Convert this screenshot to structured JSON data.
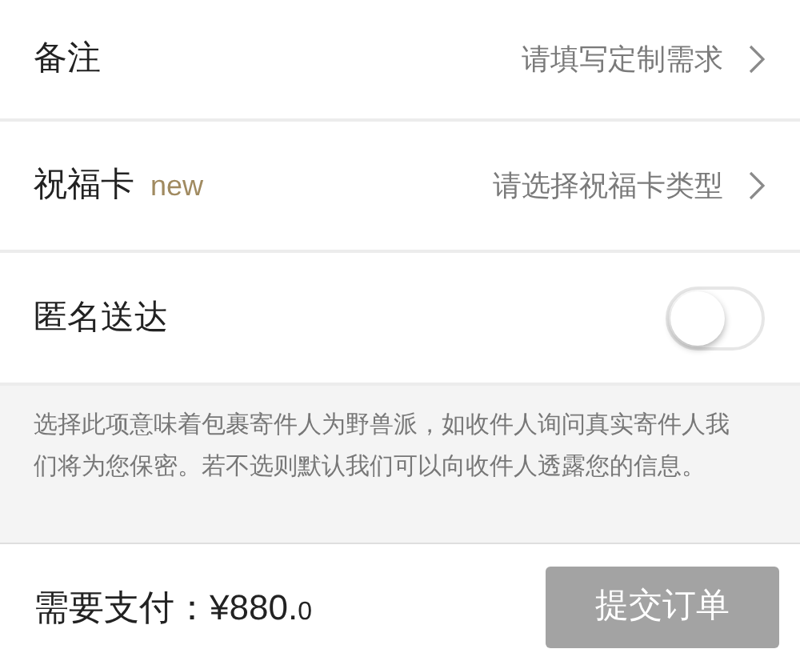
{
  "rows": [
    {
      "kind": "link",
      "label": "备注",
      "value": "请填写定制需求"
    },
    {
      "kind": "link",
      "label": "祝福卡",
      "badge": "new",
      "value": "请选择祝福卡类型"
    },
    {
      "kind": "toggle",
      "label": "匿名送达",
      "on": false
    }
  ],
  "note": "选择此项意味着包裹寄件人为野兽派，如收件人询问真实寄件人我们将为您保密。若不选则默认我们可以向收件人透露您的信息。",
  "footer": {
    "label": "需要支付：",
    "amount": "¥880.",
    "decimal": "0",
    "button": "提交订单"
  }
}
